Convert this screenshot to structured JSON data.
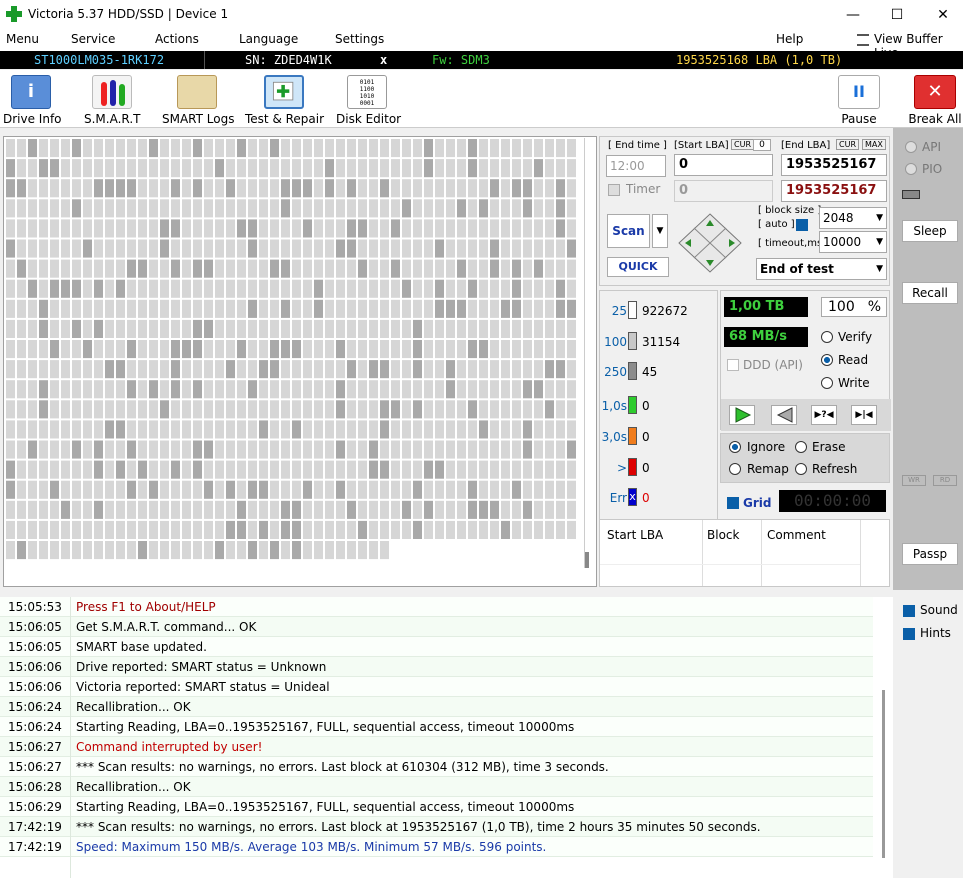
{
  "window": {
    "title": "Victoria 5.37 HDD/SSD | Device 1",
    "min": "—",
    "max": "☐",
    "close": "✕"
  },
  "menu": [
    "Menu",
    "Service",
    "Actions",
    "Language",
    "Settings"
  ],
  "menu_help": "Help",
  "view_buffer": "View Buffer Live",
  "infobar": {
    "model": "ST1000LM035-1RK172",
    "serial": "SN: ZDED4W1K",
    "x": "x",
    "fw": "Fw: SDM3",
    "lba": "1953525168 LBA (1,0 TB)"
  },
  "toolbar": [
    "Drive Info",
    "S.M.A.R.T",
    "SMART Logs",
    "Test & Repair",
    "Disk Editor"
  ],
  "toolbar_right": {
    "pause": "Pause",
    "break": "Break All"
  },
  "scan": {
    "end_time_label": "[ End time ]",
    "start_lba_label": "[Start LBA]",
    "cur": "CUR",
    "cur_val": "0",
    "end_lba_label": "[End LBA]",
    "cur2": "CUR",
    "max": "MAX",
    "time_value": "12:00",
    "start_lba": "0",
    "end_lba": "1953525167",
    "timer": "Timer",
    "start_lba2": "0",
    "end_lba2": "1953525167",
    "scan_button": "Scan",
    "quick_button": "QUICK",
    "block_size_label": "[ block size ]",
    "auto_label": "[ auto ]",
    "timeout_label": "[ timeout,ms ]",
    "block_size": "2048",
    "timeout": "10000",
    "end_action": "End of test"
  },
  "status": {
    "size": "1,00 TB",
    "percent": "100",
    "pct": "%",
    "speed": "68 MB/s",
    "ddd": "DDD (API)",
    "verify": "Verify",
    "read": "Read",
    "write": "Write",
    "ignore": "Ignore",
    "erase": "Erase",
    "remap": "Remap",
    "refresh": "Refresh",
    "grid": "Grid",
    "clock": "00:00:00"
  },
  "legend": [
    {
      "label": "25",
      "value": "922672",
      "color": "#ffffff"
    },
    {
      "label": "100",
      "value": "31154",
      "color": "#c8c8c8"
    },
    {
      "label": "250",
      "value": "45",
      "color": "#8c8c8c"
    },
    {
      "label": "1,0s",
      "value": "0",
      "color": "#2ecc2e"
    },
    {
      "label": "3,0s",
      "value": "0",
      "color": "#f07c1c"
    },
    {
      "label": ">",
      "value": "0",
      "color": "#dd0000"
    },
    {
      "label": "Err",
      "value": "0",
      "color": "#0000cc"
    }
  ],
  "err_mark": "x",
  "table": {
    "start_lba": "Start LBA",
    "block": "Block",
    "comment": "Comment"
  },
  "side": {
    "api": "API",
    "pio": "PIO",
    "sleep": "Sleep",
    "recall": "Recall",
    "wr": "WR",
    "rd": "RD",
    "passp": "Passp",
    "sound": "Sound",
    "hints": "Hints"
  },
  "log": [
    {
      "time": "15:05:53",
      "msg": "Press F1 to About/HELP",
      "color": "#a00000"
    },
    {
      "time": "15:06:05",
      "msg": "Get S.M.A.R.T. command... OK",
      "color": "#000"
    },
    {
      "time": "15:06:05",
      "msg": "SMART base updated.",
      "color": "#000"
    },
    {
      "time": "15:06:06",
      "msg": "Drive reported: SMART status = Unknown",
      "color": "#000"
    },
    {
      "time": "15:06:06",
      "msg": "Victoria reported: SMART status = Unideal",
      "color": "#000"
    },
    {
      "time": "15:06:24",
      "msg": "Recallibration... OK",
      "color": "#000"
    },
    {
      "time": "15:06:24",
      "msg": "Starting Reading, LBA=0..1953525167, FULL, sequential access, timeout 10000ms",
      "color": "#000"
    },
    {
      "time": "15:06:27",
      "msg": "Command interrupted by user!",
      "color": "#c00000"
    },
    {
      "time": "15:06:27",
      "msg": "*** Scan results: no warnings, no errors. Last block at 610304 (312 MB), time 3 seconds.",
      "color": "#000"
    },
    {
      "time": "15:06:28",
      "msg": "Recallibration... OK",
      "color": "#000"
    },
    {
      "time": "15:06:29",
      "msg": "Starting Reading, LBA=0..1953525167, FULL, sequential access, timeout 10000ms",
      "color": "#000"
    },
    {
      "time": "17:42:19",
      "msg": "*** Scan results: no warnings, no errors. Last block at 1953525167 (1,0 TB), time 2 hours 35 minutes 50 seconds.",
      "color": "#000"
    },
    {
      "time": "17:42:19",
      "msg": "Speed: Maximum 150 MB/s. Average 103 MB/s. Minimum 57 MB/s. 596 points.",
      "color": "#1a3aa8"
    }
  ]
}
